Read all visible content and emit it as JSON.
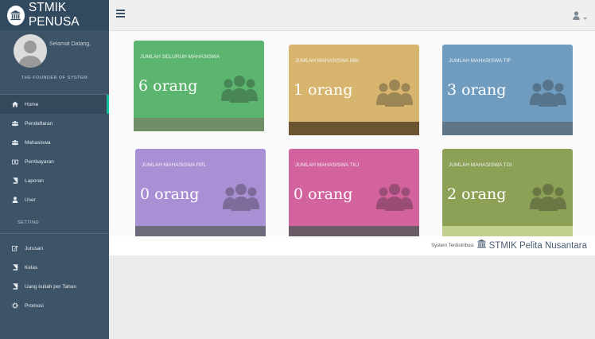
{
  "brand": {
    "title": "STMIK PENUSA"
  },
  "profile": {
    "welcome": "Selamat Datang,",
    "role": "THE FOUNDER OF SYSTEM"
  },
  "menu": [
    {
      "label": "Home",
      "icon": "home-icon"
    },
    {
      "label": "Pendaftaran",
      "icon": "users-icon"
    },
    {
      "label": "Mahasiswa",
      "icon": "users-icon"
    },
    {
      "label": "Pembayaran",
      "icon": "money-icon"
    },
    {
      "label": "Laporan",
      "icon": "book-icon"
    },
    {
      "label": "User",
      "icon": "user-icon"
    }
  ],
  "settings_title": "SETTING",
  "settings_menu": [
    {
      "label": "Jurusan",
      "icon": "edit-icon"
    },
    {
      "label": "Kelas",
      "icon": "book-icon"
    },
    {
      "label": "Uang kuliah per Tahun",
      "icon": "book-icon"
    },
    {
      "label": "Promosi",
      "icon": "gear-icon"
    }
  ],
  "tiles": [
    {
      "title": "JUMLAH SELURUH MAHASISWA",
      "value": "6 orang",
      "bg": "#5bb56f",
      "footer": "#6e8f68"
    },
    {
      "title": "JUMLAH MAHASISWA MIK",
      "value": "1 orang",
      "bg": "#d8b56e",
      "footer": "#6b5531"
    },
    {
      "title": "JUMLAH MAHASISWA TIF",
      "value": "3 orang",
      "bg": "#6f9cbf",
      "footer": "#5e7487"
    },
    {
      "title": "JUMLAH MAHASISWA RPL",
      "value": "0 orang",
      "bg": "#a98fd3",
      "footer": "#6d6a7c"
    },
    {
      "title": "JUMLAH MAHASISWA TKJ",
      "value": "0 orang",
      "bg": "#d3639d",
      "footer": "#6a5c67"
    },
    {
      "title": "JUMLAH MAHASISWA TGI",
      "value": "2 orang",
      "bg": "#8ca156",
      "footer": "#c1cf8f"
    }
  ],
  "footer": {
    "prefix": "System Terdistribusi",
    "name": "STMIK Pelita Nusantara"
  }
}
